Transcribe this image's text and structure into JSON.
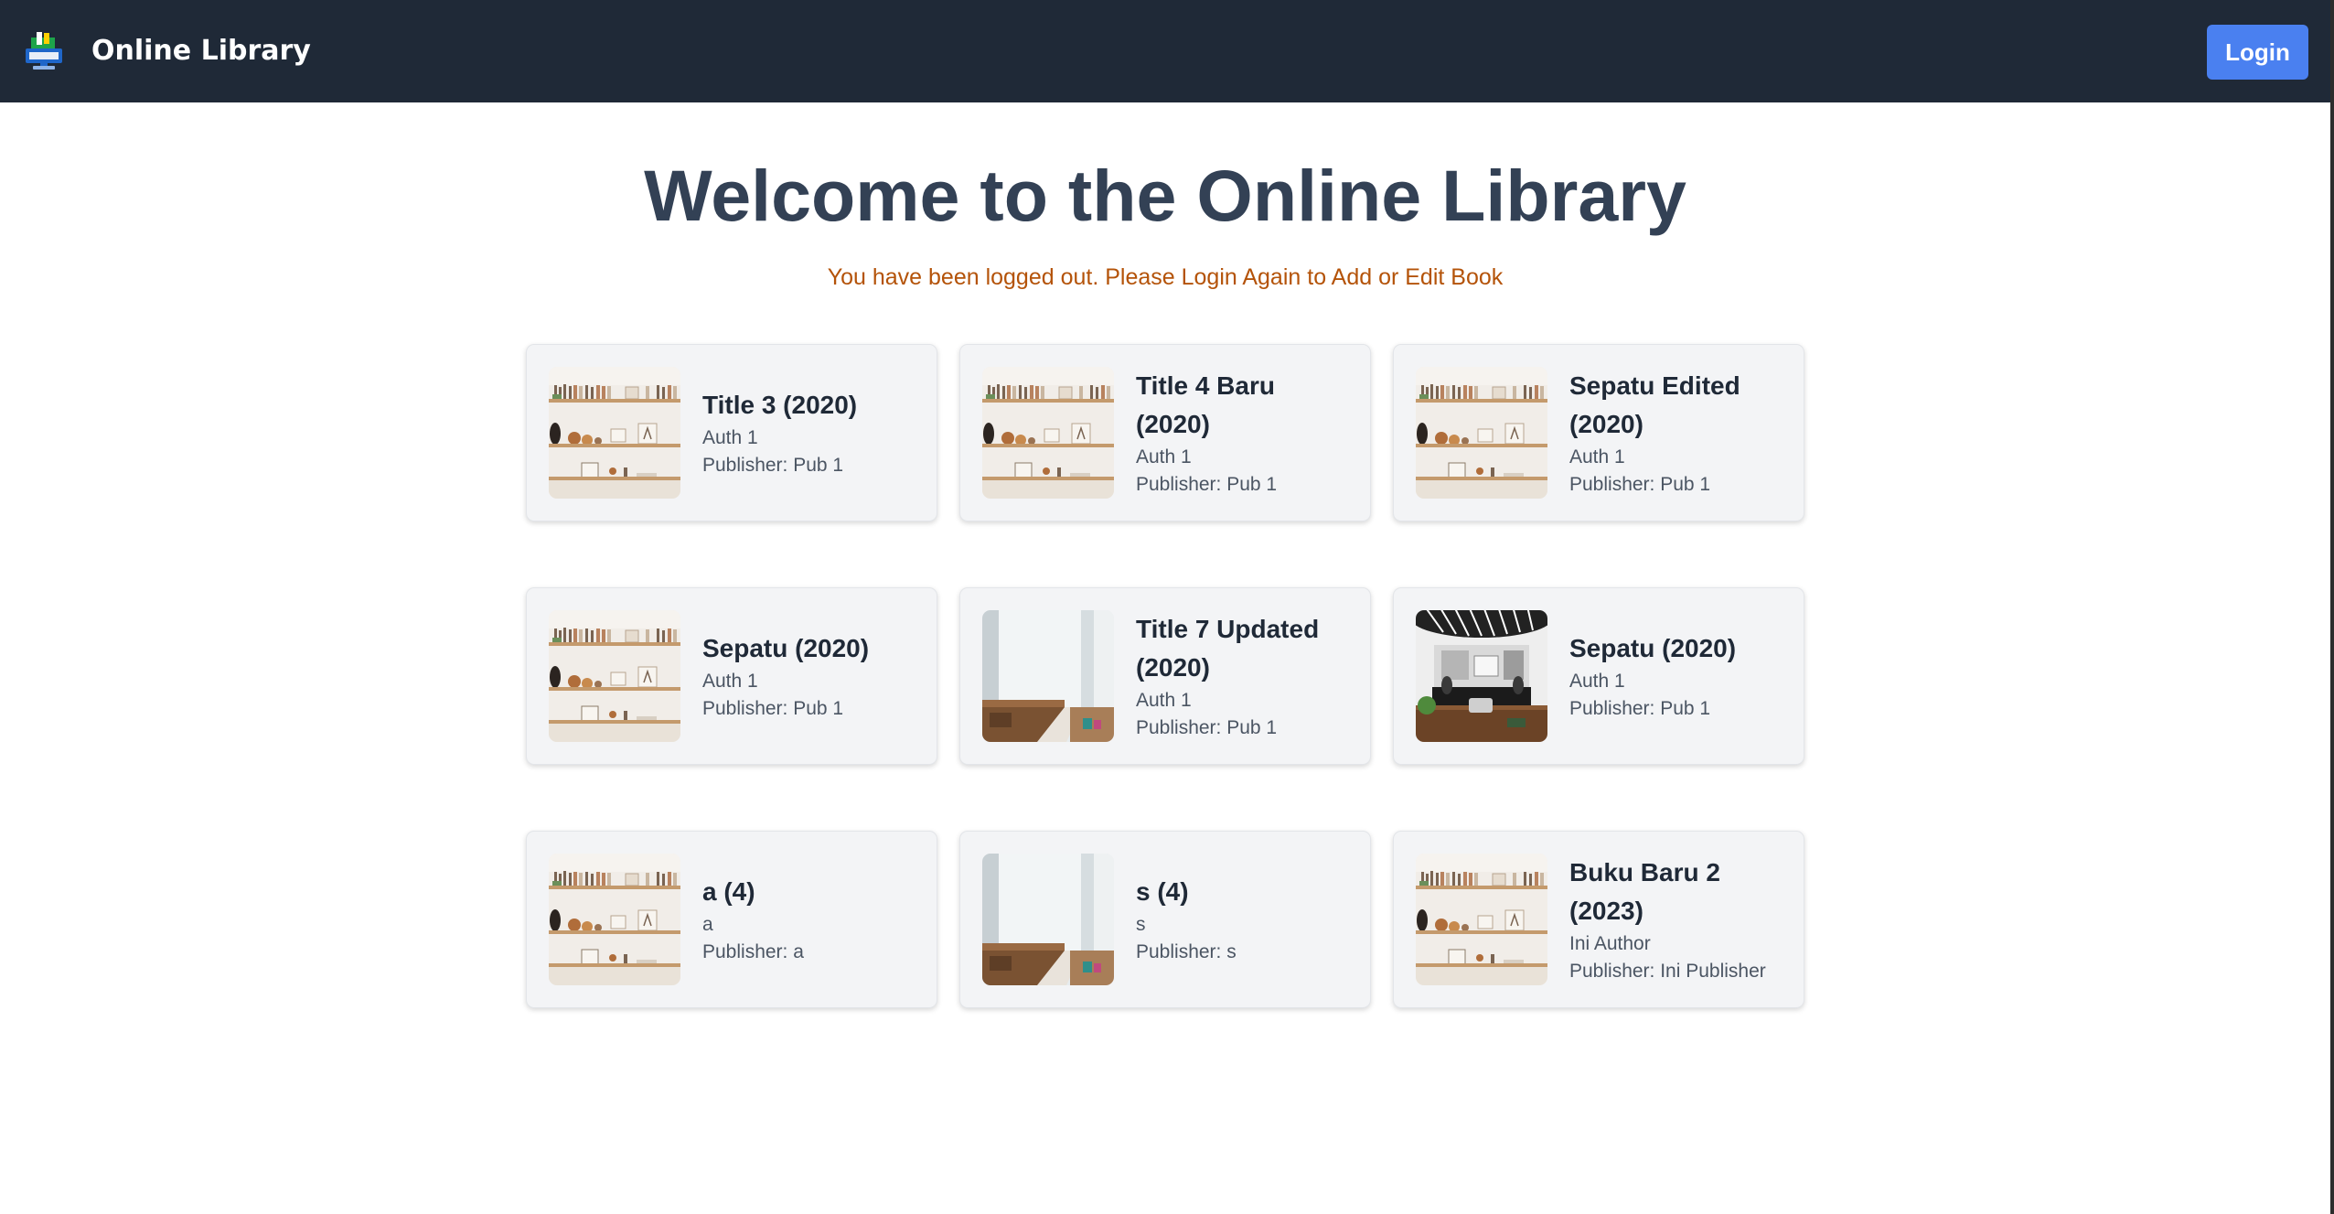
{
  "navbar": {
    "brand": "Online Library",
    "login_label": "Login",
    "logo_icon": "library-logo-icon"
  },
  "main": {
    "heading": "Welcome to the Online Library",
    "notice": "You have been logged out. Please Login Again to Add or Edit Book"
  },
  "books": [
    {
      "title": "Title 3 (2020)",
      "author": "Auth 1",
      "publisher": "Publisher: Pub 1",
      "image": "bookshelf-image"
    },
    {
      "title": "Title 4 Baru (2020)",
      "author": "Auth 1",
      "publisher": "Publisher: Pub 1",
      "image": "bookshelf-image"
    },
    {
      "title": "Sepatu Edited (2020)",
      "author": "Auth 1",
      "publisher": "Publisher: Pub 1",
      "image": "bookshelf-image"
    },
    {
      "title": "Sepatu (2020)",
      "author": "Auth 1",
      "publisher": "Publisher: Pub 1",
      "image": "bookshelf-image"
    },
    {
      "title": "Title 7 Updated (2020)",
      "author": "Auth 1",
      "publisher": "Publisher: Pub 1",
      "image": "room-image"
    },
    {
      "title": "Sepatu (2020)",
      "author": "Auth 1",
      "publisher": "Publisher: Pub 1",
      "image": "office-image"
    },
    {
      "title": "a (4)",
      "author": "a",
      "publisher": "Publisher: a",
      "image": "bookshelf-image"
    },
    {
      "title": "s (4)",
      "author": "s",
      "publisher": "Publisher: s",
      "image": "room-image"
    },
    {
      "title": "Buku Baru 2 (2023)",
      "author": "Ini Author",
      "publisher": "Publisher: Ini Publisher",
      "image": "bookshelf-image"
    }
  ],
  "colors": {
    "navbar_bg": "#1f2937",
    "login_button": "#4a80f0",
    "heading": "#334155",
    "notice": "#b45309",
    "card_bg": "#f3f4f6"
  }
}
